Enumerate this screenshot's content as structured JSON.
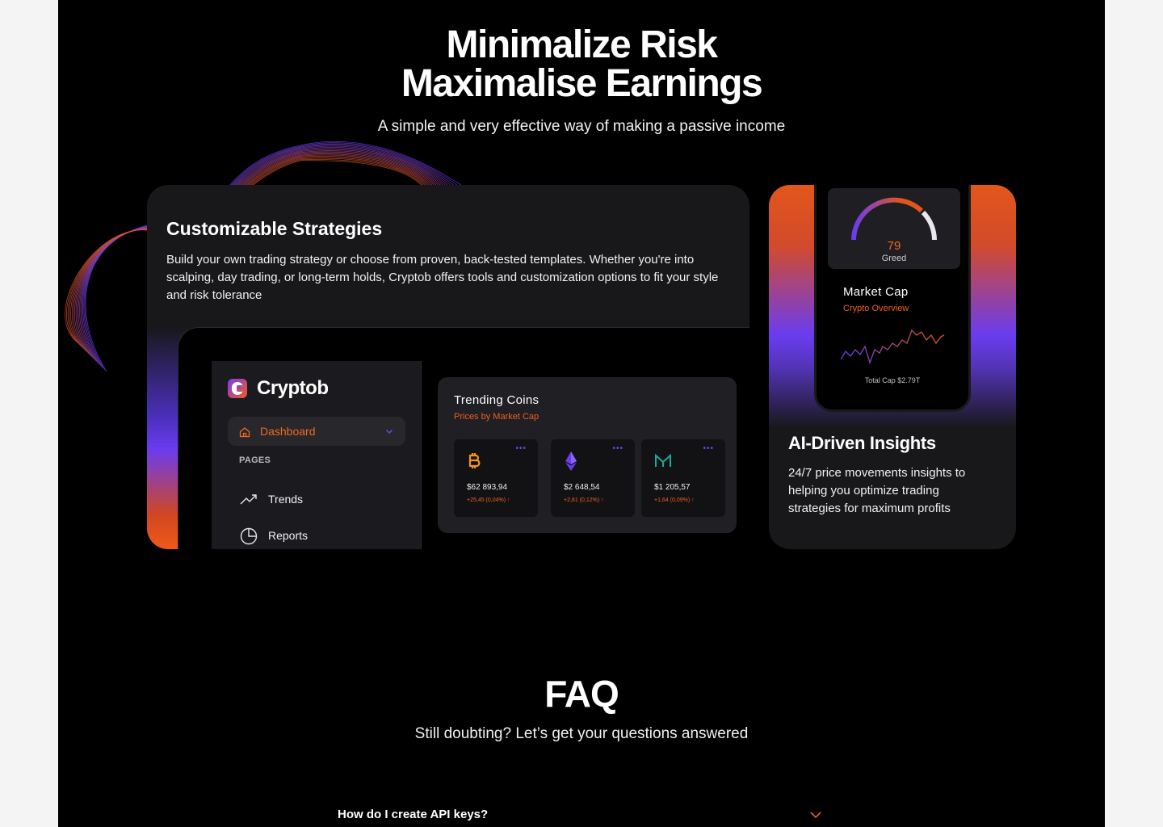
{
  "hero": {
    "title_line1": "Minimalize Risk",
    "title_line2": "Maximalise Earnings",
    "subtitle": "A simple and very effective way of making a passive income"
  },
  "strategies_card": {
    "title": "Customizable Strategies",
    "description": "Build your own trading strategy or choose from proven, back-tested templates. Whether you're into scalping, day trading, or long-term holds, Cryptob offers tools and customization options to fit your style and risk tolerance"
  },
  "app_preview": {
    "brand": "Cryptob",
    "dashboard_label": "Dashboard",
    "pages_heading": "PAGES",
    "nav": [
      {
        "label": "Trends",
        "icon": "trend-up-icon"
      },
      {
        "label": "Reports",
        "icon": "pie-chart-icon"
      }
    ],
    "trending": {
      "title": "Trending Coins",
      "subtitle": "Prices by Market Cap",
      "coins": [
        {
          "icon": "bitcoin-icon",
          "price": "$62 893,94",
          "change": "+25,45 (0,04%)",
          "arrow": "↑",
          "color": "#f7931a"
        },
        {
          "icon": "ethereum-icon",
          "price": "$2 648,54",
          "change": "+2,81 (0,12%)",
          "arrow": "↑",
          "color": "#7b52f0"
        },
        {
          "icon": "maker-icon",
          "price": "$1 205,57",
          "change": "+1,64 (0,09%)",
          "arrow": "↑",
          "color": "#1aab9b"
        }
      ]
    }
  },
  "insights_card": {
    "gauge_value": "79",
    "gauge_label": "Greed",
    "market_cap_title": "Market Cap",
    "market_cap_subtitle": "Crypto Overview",
    "total_cap": "Total Cap $2.79T",
    "title": "AI-Driven Insights",
    "description": "24/7 price movements insights to helping you optimize trading strategies for maximum profits"
  },
  "faq": {
    "title": "FAQ",
    "subtitle": "Still doubting? Let’s get your questions answered",
    "questions": [
      {
        "question": "How do I create API keys?"
      }
    ]
  },
  "colors": {
    "accent_orange": "#ef5f1e",
    "accent_purple": "#6a3cf0",
    "card_bg": "#18181b",
    "page_bg": "#000000"
  }
}
